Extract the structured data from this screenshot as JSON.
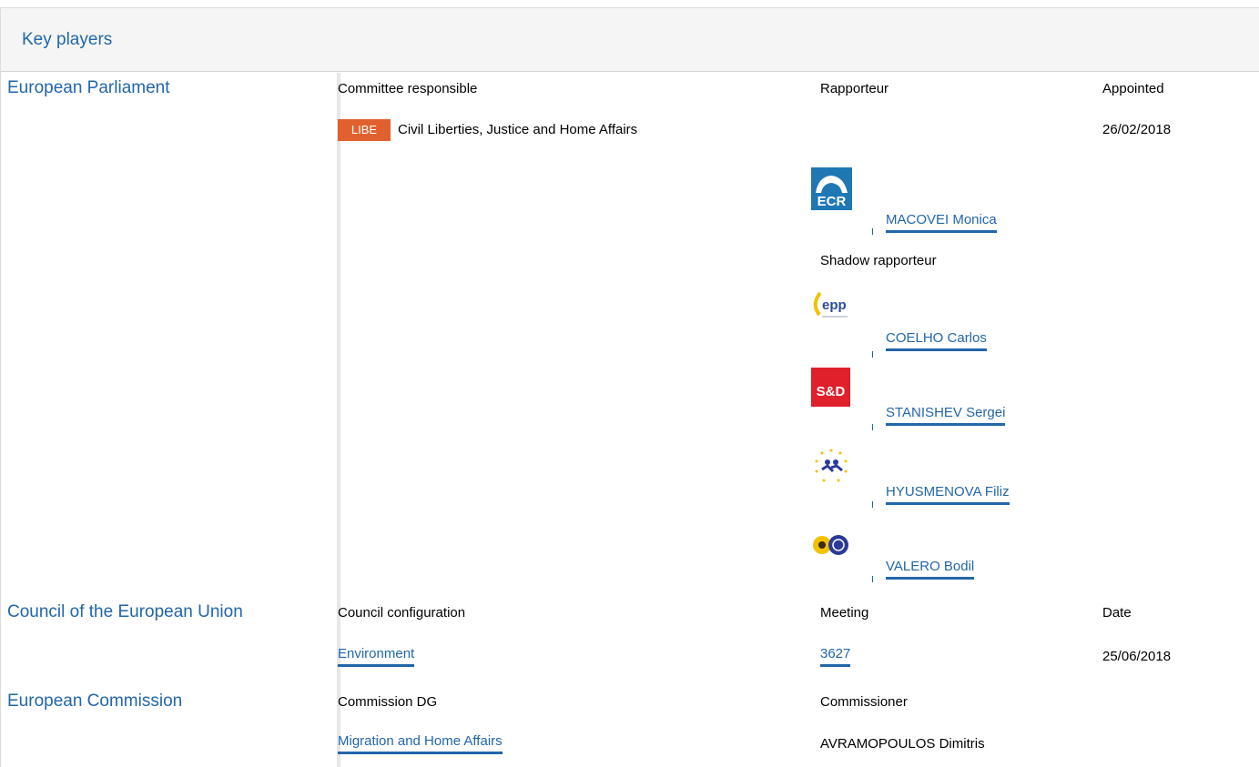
{
  "section": {
    "title": "Key players"
  },
  "european_parliament": {
    "title": "European Parliament",
    "headers": {
      "committee": "Committee responsible",
      "rapporteur": "Rapporteur",
      "appointed": "Appointed"
    },
    "committee": {
      "code": "LIBE",
      "name": "Civil Liberties, Justice and Home Affairs",
      "appointed": "26/02/2018"
    },
    "rapporteur": {
      "group": "ECR",
      "name": "MACOVEI Monica"
    },
    "shadow_label": "Shadow rapporteur",
    "shadows": [
      {
        "group": "EPP",
        "logo_text": "epp",
        "name": "COELHO Carlos"
      },
      {
        "group": "S&D",
        "logo_text": "S&D",
        "name": "STANISHEV Sergei"
      },
      {
        "group": "ALDE",
        "name": "HYUSMENOVA Filiz"
      },
      {
        "group": "Verts/ALE",
        "name": "VALERO Bodil"
      }
    ]
  },
  "council": {
    "title": "Council of the European Union",
    "headers": {
      "configuration": "Council configuration",
      "meeting": "Meeting",
      "date": "Date"
    },
    "configuration": "Environment",
    "meeting": "3627",
    "date": "25/06/2018"
  },
  "commission": {
    "title": "European Commission",
    "headers": {
      "dg": "Commission DG",
      "commissioner": "Commissioner"
    },
    "dg": "Migration and Home Affairs",
    "commissioner": "AVRAMOPOULOS Dimitris"
  },
  "colors": {
    "link": "#2266aa",
    "badge": "#e0612f",
    "header_bg": "#f5f5f5"
  }
}
